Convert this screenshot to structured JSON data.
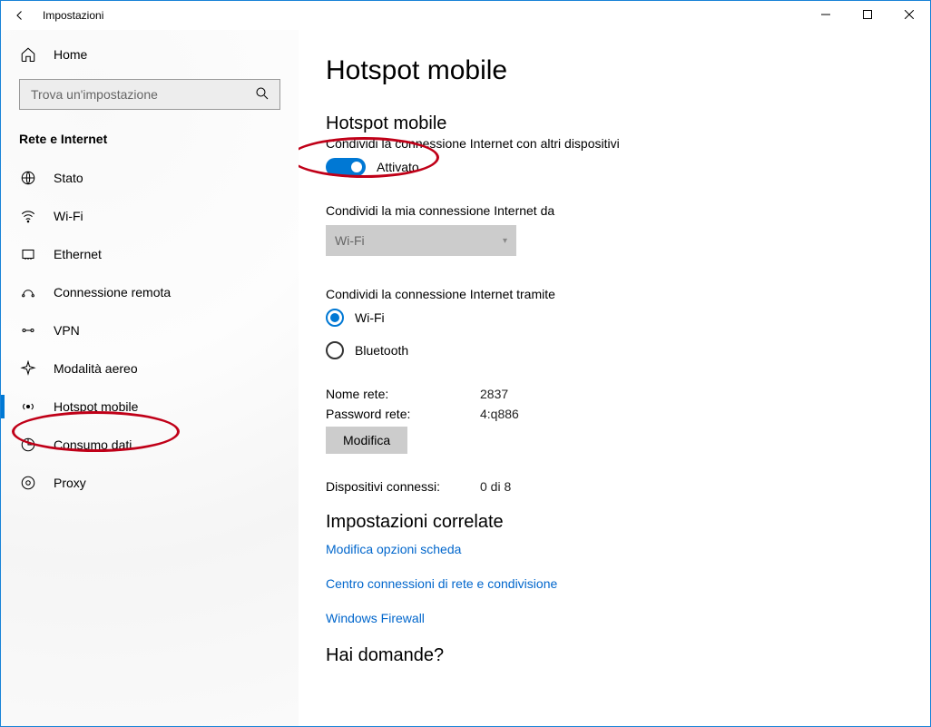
{
  "window": {
    "title": "Impostazioni"
  },
  "sidebar": {
    "home_label": "Home",
    "search_placeholder": "Trova un'impostazione",
    "section": "Rete e Internet",
    "items": [
      {
        "label": "Stato",
        "icon": "status-icon"
      },
      {
        "label": "Wi-Fi",
        "icon": "wifi-icon"
      },
      {
        "label": "Ethernet",
        "icon": "ethernet-icon"
      },
      {
        "label": "Connessione remota",
        "icon": "dialup-icon"
      },
      {
        "label": "VPN",
        "icon": "vpn-icon"
      },
      {
        "label": "Modalità aereo",
        "icon": "airplane-icon"
      },
      {
        "label": "Hotspot mobile",
        "icon": "hotspot-icon"
      },
      {
        "label": "Consumo dati",
        "icon": "data-usage-icon"
      },
      {
        "label": "Proxy",
        "icon": "proxy-icon"
      }
    ],
    "selected_index": 6
  },
  "main": {
    "page_title": "Hotspot mobile",
    "section_title": "Hotspot mobile",
    "share_desc": "Condividi la connessione Internet con altri dispositivi",
    "toggle_state_label": "Attivato",
    "toggle_on": true,
    "share_from_label": "Condividi la mia connessione Internet da",
    "share_from_value": "Wi-Fi",
    "share_via_label": "Condividi la connessione Internet tramite",
    "share_via_options": [
      {
        "label": "Wi-Fi",
        "selected": true
      },
      {
        "label": "Bluetooth",
        "selected": false
      }
    ],
    "network_name_label": "Nome rete:",
    "network_name_value": "2837",
    "network_password_label": "Password rete:",
    "network_password_value": "4:q886",
    "edit_button": "Modifica",
    "connected_label": "Dispositivi connessi:",
    "connected_value": "0 di 8",
    "related_title": "Impostazioni correlate",
    "related_links": [
      "Modifica opzioni scheda",
      "Centro connessioni di rete e condivisione",
      "Windows Firewall"
    ],
    "questions_title": "Hai domande?"
  }
}
